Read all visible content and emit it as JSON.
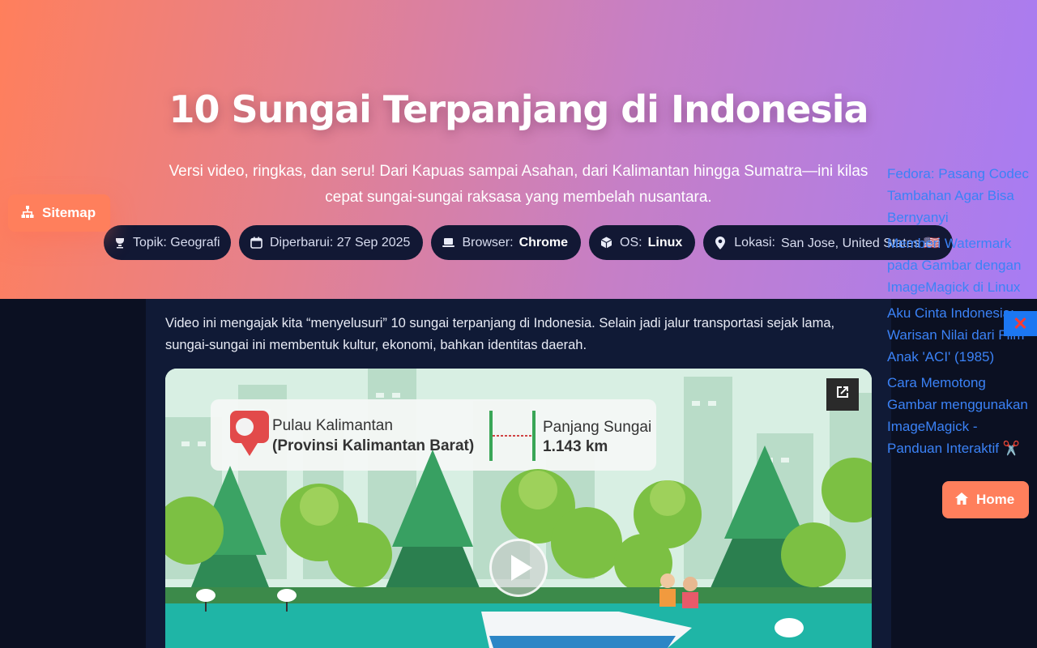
{
  "header": {
    "title": "10 Sungai Terpanjang di Indonesia",
    "subtitle": "Versi video, ringkas, dan seru! Dari Kapuas sampai Asahan, dari Kalimantan hingga Sumatra—ini kilas cepat sungai-sungai raksasa yang membelah nusantara."
  },
  "chips": {
    "topic": "Topik: Geografi",
    "updated": "Diperbarui: 27 Sep 2025",
    "browser_label": "Browser:",
    "browser_value": "Chrome",
    "os_label": "OS:",
    "os_value": "Linux",
    "location_label": "Lokasi:",
    "location_value": "San Jose, United States 🇺🇸"
  },
  "nav": {
    "sitemap_label": "Sitemap",
    "home_label": "Home"
  },
  "content": {
    "intro": "Video ini mengajak kita “menyelusuri” 10 sungai terpanjang di Indonesia. Selain jadi jalur transportasi sejak lama, sungai-sungai ini membentuk kultur, ekonomi, bahkan identitas daerah."
  },
  "video": {
    "island_text": "Pulau Kalimantan",
    "province_text": "(Provinsi Kalimantan Barat)",
    "length_label": "Panjang Sungai",
    "length_value": "1.143 km"
  },
  "sidebar": {
    "links": [
      "Fedora: Pasang Codec Tambahan Agar Bisa Bernyanyi",
      "Memberi Watermark pada Gambar dengan ImageMagick di Linux",
      "Aku Cinta Indonesia: Warisan Nilai dari Film Anak 'ACI' (1985)",
      "Cara Memotong Gambar menggunakan ImageMagick - Panduan Interaktif ✂️"
    ]
  },
  "icons": {
    "topic": "trophy-icon",
    "updated": "calendar-icon",
    "browser": "laptop-icon",
    "os": "cube-icon",
    "location": "map-pin-icon",
    "sitemap": "sitemap-icon",
    "home": "home-icon",
    "close": "close-icon",
    "external": "external-link-icon",
    "play": "play-icon"
  },
  "colors": {
    "accent": "#ff7f5c",
    "link": "#3b82f6",
    "chip_bg": "#121834",
    "page_bg": "#0b1022"
  }
}
